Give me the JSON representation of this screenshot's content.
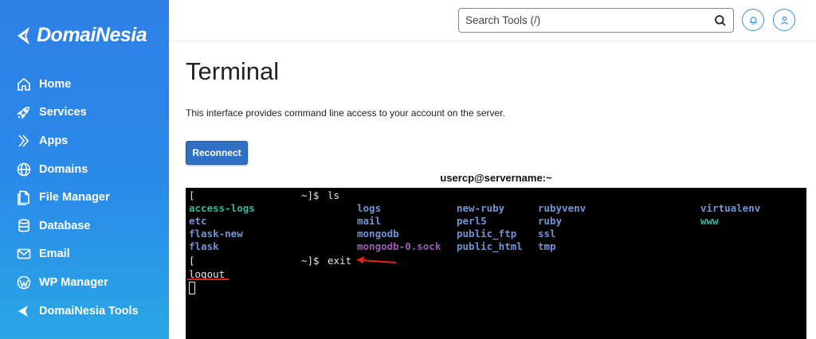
{
  "brand": {
    "name": "DomaiNesia"
  },
  "sidebar": {
    "items": [
      {
        "label": "Home",
        "icon": "home-icon"
      },
      {
        "label": "Services",
        "icon": "rocket-icon"
      },
      {
        "label": "Apps",
        "icon": "apps-icon"
      },
      {
        "label": "Domains",
        "icon": "globe-icon"
      },
      {
        "label": "File Manager",
        "icon": "file-icon"
      },
      {
        "label": "Database",
        "icon": "database-icon"
      },
      {
        "label": "Email",
        "icon": "mail-icon"
      },
      {
        "label": "WP Manager",
        "icon": "wordpress-icon"
      },
      {
        "label": "DomaiNesia Tools",
        "icon": "tools-icon"
      }
    ]
  },
  "header": {
    "search_placeholder": "Search Tools (/)",
    "search_icon": "search-icon",
    "notification_icon": "bell-icon",
    "user_icon": "user-icon"
  },
  "main": {
    "title": "Terminal",
    "description": "This interface provides command line access to your account on the server.",
    "reconnect_label": "Reconnect",
    "terminal_title": "usercp@servername:~"
  },
  "terminal": {
    "prompt_open": "[",
    "prompt_close": "~]$",
    "cmd1": "ls",
    "cmd2": "exit",
    "logout": "logout",
    "ls_rows": [
      [
        "access-logs",
        "logs",
        "new-ruby",
        "rubyvenv",
        "virtualenv"
      ],
      [
        "etc",
        "mail",
        "perl5",
        "ruby",
        "www"
      ],
      [
        "flask-new",
        "mongodb",
        "public_ftp",
        "ssl",
        ""
      ],
      [
        "flask",
        "mongodb-0.sock",
        "public_html",
        "tmp",
        ""
      ]
    ]
  },
  "colors": {
    "sidebar_top": "#2f7fe6",
    "sidebar_bottom": "#2aa6e6",
    "accent": "#3a8fe8",
    "button": "#2f70c4",
    "annotation": "#e2231a",
    "term_teal": "#2fb8a4",
    "term_blue": "#6f95d6",
    "term_purple": "#9a5eb0"
  }
}
